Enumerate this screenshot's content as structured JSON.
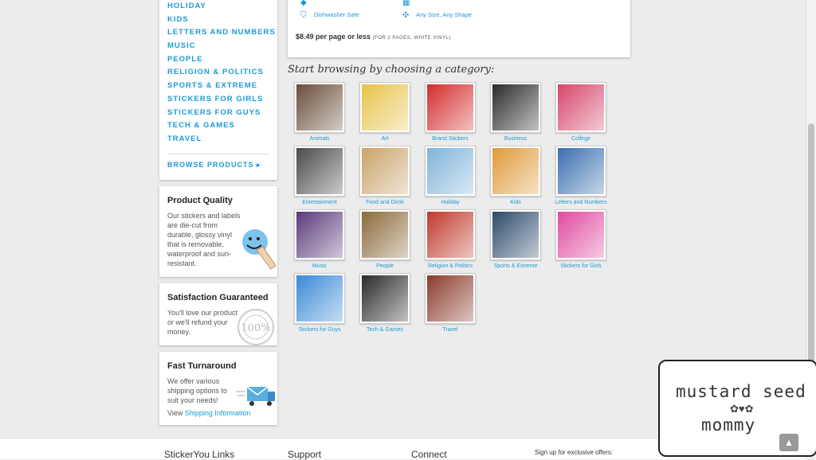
{
  "sidebar": {
    "categories": [
      "HOLIDAY",
      "KIDS",
      "LETTERS AND NUMBERS",
      "MUSIC",
      "PEOPLE",
      "RELIGION & POLITICS",
      "SPORTS & EXTREME",
      "STICKERS FOR GIRLS",
      "STICKERS FOR GUYS",
      "TECH & GAMES",
      "TRAVEL"
    ],
    "browse_label": "BROWSE PRODUCTS ▸"
  },
  "quality": {
    "title": "Product Quality",
    "text": "Our stickers and labels are die-cut from durable, glossy vinyl that is removable, waterproof and sun-resistant."
  },
  "satisfaction": {
    "title": "Satisfaction Guaranteed",
    "text": "You'll love our product or we'll refund your money."
  },
  "turnaround": {
    "title": "Fast Turnaround",
    "text": "We offer various shipping options to suit your needs!",
    "view": "View",
    "link": "Shipping Information"
  },
  "features": {
    "dishwasher": "Dishwasher Safe",
    "anysize": "Any Size, Any Shape"
  },
  "price": {
    "main": "$8.49 per page or less",
    "note": "(for 2 pages, white vinyl)"
  },
  "browse_heading": "Start browsing by choosing a category:",
  "grid": [
    {
      "label": "Animals",
      "color": "#6a4e3a"
    },
    {
      "label": "Art",
      "color": "#e8c34a"
    },
    {
      "label": "Brand Stickers",
      "color": "#d32c2c"
    },
    {
      "label": "Business",
      "color": "#2a2a2a"
    },
    {
      "label": "College",
      "color": "#d6476a"
    },
    {
      "label": "Entertainment",
      "color": "#4a4a4a"
    },
    {
      "label": "Food and Drink",
      "color": "#c9a36a"
    },
    {
      "label": "Holiday",
      "color": "#7fb3d9"
    },
    {
      "label": "Kids",
      "color": "#e09a3a"
    },
    {
      "label": "Letters and Numbers",
      "color": "#3a6fb0"
    },
    {
      "label": "Music",
      "color": "#5a3a7a"
    },
    {
      "label": "People",
      "color": "#8b6a3a"
    },
    {
      "label": "Religion & Politics",
      "color": "#c0392b"
    },
    {
      "label": "Sports & Extreme",
      "color": "#2c4a6a"
    },
    {
      "label": "Stickers for Girls",
      "color": "#e04aa0"
    },
    {
      "label": "Stickers for Guys",
      "color": "#3a8ad6"
    },
    {
      "label": "Tech & Games",
      "color": "#2a2a2a"
    },
    {
      "label": "Travel",
      "color": "#8a3a2a"
    }
  ],
  "footer": {
    "links": "StickerYou Links",
    "support": "Support",
    "connect": "Connect",
    "signup": "Sign up for exclusive offers:"
  },
  "logo": {
    "line1": "mustard seed",
    "ornament": "✿♥✿",
    "line2": "mommy"
  },
  "to_top": "▲"
}
